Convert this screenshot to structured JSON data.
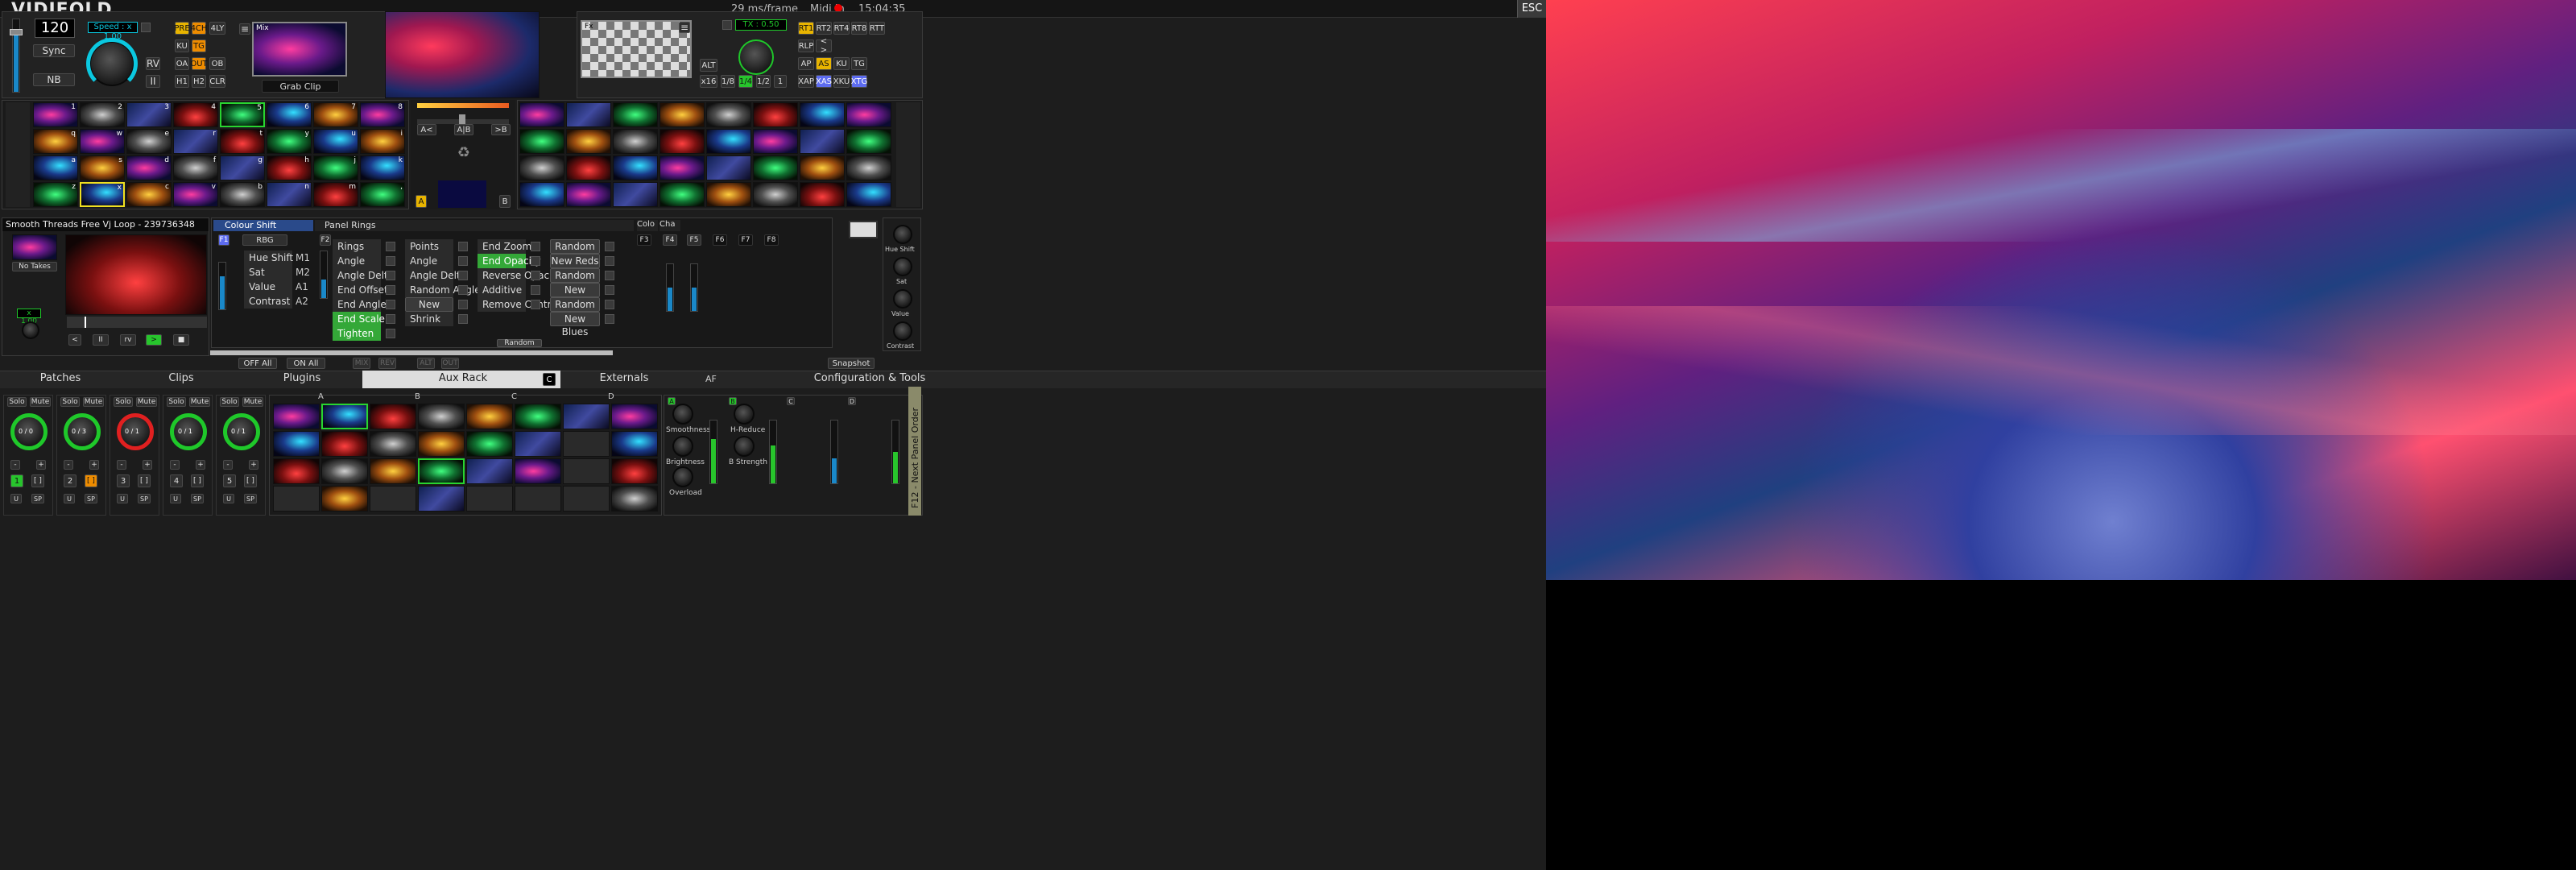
{
  "app": {
    "title": "VIDIFOLD",
    "frame_time": "29 ms/frame",
    "midi": "Midi In",
    "clock": "15:04:35",
    "esc": "ESC"
  },
  "deck_left": {
    "bpm": "120",
    "sync": "Sync",
    "nb": "NB",
    "speed": "Speed : x 1.00",
    "rv": "RV",
    "pause": "II",
    "modes": [
      "PRE",
      "4CH",
      "4LY",
      "KU",
      "TG",
      "OA",
      "OUT",
      "OB",
      "H1",
      "H2",
      "CLR"
    ],
    "mix_label": "Mix",
    "grab_clip": "Grab Clip",
    "menu": "≡"
  },
  "deck_right": {
    "tx": "TX : 0.50",
    "menu": "≡",
    "fx_label": "Fx",
    "row1": [
      "RT1",
      "RT2",
      "RT4",
      "RT8",
      "RTT"
    ],
    "row2": [
      "RLP",
      "< >"
    ],
    "row3": [
      "AP",
      "AS",
      "KU",
      "TG"
    ],
    "row4": [
      "XAP",
      "XAS",
      "XKU",
      "XTG"
    ],
    "alt": "ALT",
    "rates": [
      "x16",
      "1/8",
      "1/4",
      "1/2",
      "1"
    ]
  },
  "crossfade": {
    "a_btn": "A<",
    "ab_btn": "A|B",
    "b_btn": ">B",
    "a_tag": "A",
    "b_tag": "B"
  },
  "clip_grid": {
    "letters": [
      "1",
      "2",
      "3",
      "4",
      "5",
      "6",
      "7",
      "8",
      "q",
      "w",
      "e",
      "r",
      "t",
      "y",
      "u",
      "i",
      "a",
      "s",
      "d",
      "f",
      "g",
      "h",
      "j",
      "k",
      "z",
      "x",
      "c",
      "v",
      "b",
      "n",
      "m",
      ","
    ]
  },
  "clip_info": {
    "name": "Smooth Threads Free Vj Loop - 239736348",
    "no_takes": "No Takes",
    "speed": "x 1.00",
    "transport": [
      "<",
      "II",
      "rv",
      ">",
      "■"
    ]
  },
  "fx_colour": {
    "title": "Colour Shift",
    "f1": "F1",
    "mode": "RBG",
    "params": [
      {
        "label": "Hue Shift",
        "tag": "M1"
      },
      {
        "label": "Sat",
        "tag": "M2"
      },
      {
        "label": "Value",
        "tag": "A1"
      },
      {
        "label": "Contrast",
        "tag": "A2"
      }
    ]
  },
  "fx_rings": {
    "title": "Panel Rings",
    "f2": "F2",
    "col1": [
      "Rings",
      "Angle",
      "Angle Delta",
      "End Offset",
      "End Angle",
      "End Scale",
      "Tighten"
    ],
    "col2": [
      "Points",
      "Angle",
      "Angle Delta",
      "Random Angles",
      "New Angles",
      "Shrink"
    ],
    "col3": [
      "End Zoom",
      "End Opacity",
      "Reverse Opacity",
      "Additive",
      "Remove Centre"
    ],
    "col4": [
      "Random Red",
      "New Reds",
      "Random Green",
      "New Greens",
      "Random Blue",
      "New Blues"
    ],
    "random": "Random"
  },
  "fx_slots": {
    "labels": [
      "F3",
      "F4",
      "F5",
      "F6",
      "F7",
      "F8"
    ],
    "mini_titles": [
      "Colo",
      "Cha"
    ]
  },
  "fx_bottom": {
    "off_all": "OFF All",
    "on_all": "ON All",
    "mix": "MIX",
    "snapshot": "Snapshot",
    "dim": [
      "REV",
      "ALT",
      "OUT"
    ]
  },
  "right_knobs": [
    "Hue Shift",
    "Sat",
    "Value",
    "Contrast"
  ],
  "tabs": [
    "Patches",
    "Clips",
    "Plugins",
    "Aux Rack",
    "Externals",
    "Configuration & Tools"
  ],
  "aux": {
    "c_btn": "C",
    "af": "AF"
  },
  "channels": [
    {
      "num": "1",
      "solo": "Solo",
      "mute": "Mute",
      "u": "U",
      "sp": "SP",
      "bracket": "[ ]",
      "minus": "-",
      "plus": "+",
      "vals": "0 / 0"
    },
    {
      "num": "2",
      "solo": "Solo",
      "mute": "Mute",
      "u": "U",
      "sp": "SP",
      "bracket": "[ ]",
      "minus": "-",
      "plus": "+",
      "vals": "0 / 3"
    },
    {
      "num": "3",
      "solo": "Solo",
      "mute": "Mute",
      "u": "U",
      "sp": "SP",
      "bracket": "[ ]",
      "minus": "-",
      "plus": "+",
      "vals": "0 / 1"
    },
    {
      "num": "4",
      "solo": "Solo",
      "mute": "Mute",
      "u": "U",
      "sp": "SP",
      "bracket": "[ ]",
      "minus": "-",
      "plus": "+",
      "vals": "0 / 1"
    },
    {
      "num": "5",
      "solo": "Solo",
      "mute": "Mute",
      "u": "U",
      "sp": "SP",
      "bracket": "[ ]",
      "minus": "-",
      "plus": "+",
      "vals": "0 / 1"
    }
  ],
  "aux_cols": [
    "A",
    "B",
    "C",
    "D"
  ],
  "aux_fx": {
    "a": [
      "A",
      "Smoothness",
      "Brightness",
      "Overload"
    ],
    "b": [
      "B",
      "H-Reduce",
      "B Strength"
    ],
    "c": "C",
    "d": "D",
    "side": "F12 - Next Panel Order"
  }
}
